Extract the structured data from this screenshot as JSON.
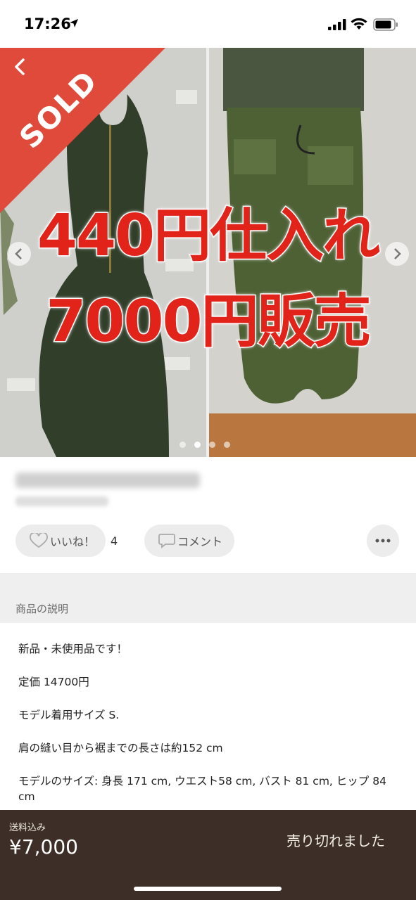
{
  "status_bar": {
    "time": "17:26"
  },
  "hero": {
    "sold_label": "SOLD",
    "overlay_line1": "440円仕入れ",
    "overlay_line2": "7000円販売",
    "dots_count": 4,
    "active_dot": 1,
    "colors": {
      "sold_banner": "#e04a3b",
      "overlay_text": "#e2231a"
    }
  },
  "actions": {
    "like_label": "いいね！",
    "like_count": "4",
    "comment_label": "コメント"
  },
  "description": {
    "heading": "商品の説明",
    "lines": [
      "新品・未使用品です！",
      "定価 14700円",
      "モデル着用サイズ S.",
      "肩の縫い目から裾までの長さは約152 cm",
      "モデルのサイズ: 身長 171 cm, ウエスト58 cm, バスト 81 cm, ヒップ 84 cm"
    ]
  },
  "footer": {
    "shipping": "送料込み",
    "price": "¥7,000",
    "status": "売り切れました",
    "colors": {
      "background": "#3d2f27"
    }
  }
}
